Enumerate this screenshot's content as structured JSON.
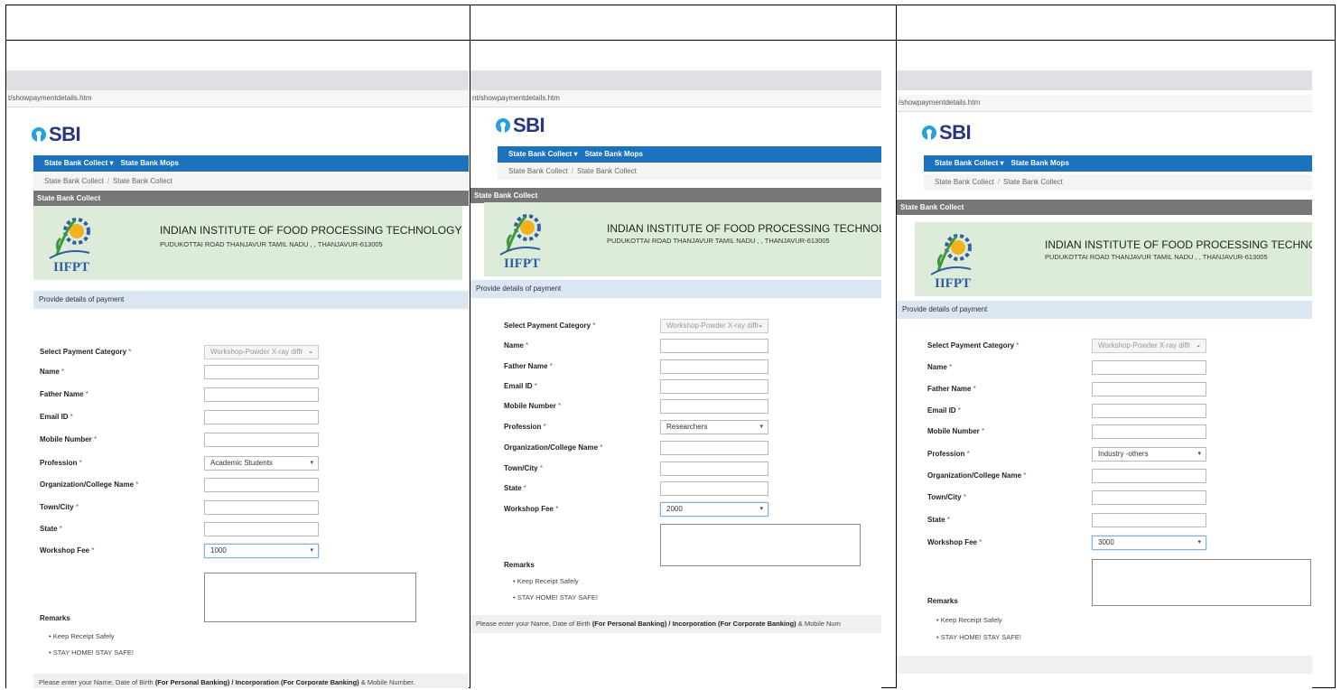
{
  "panels": [
    {
      "url": "t/showpaymentdetails.htm",
      "logo": "SBI",
      "nav": [
        "State Bank Collect ▾",
        "State Bank Mops"
      ],
      "breadcrumb": [
        "State Bank Collect",
        "State Bank Collect"
      ],
      "panel_title": "State Bank Collect",
      "institute_name": "INDIAN INSTITUTE OF FOOD PROCESSING TECHNOLOGY",
      "institute_address": "PUDUKOTTAI ROAD THANJAVUR TAMIL NADU , , THANJAVUR-613005",
      "emblem_text": "IIFPT",
      "section_title": "Provide details of payment",
      "labels": [
        "Select Payment Category *",
        "Name *",
        "Father Name *",
        "Email ID *",
        "Mobile Number *",
        "Profession *",
        "Organization/College Name *",
        "Town/City *",
        "State *",
        "Workshop Fee *"
      ],
      "payment_category": "Workshop-Powder X-ray diffr",
      "profession": "Academic Students",
      "workshop_fee": "1000",
      "remarks_title": "Remarks",
      "remarks": [
        "Keep Receipt Safely",
        "STAY HOME! STAY SAFE!"
      ],
      "footer_pre": "Please enter your Name, Date of Birth ",
      "footer_bold": "(For Personal Banking) / Incorporation (For Corporate Banking)",
      "footer_post": " & Mobile Number."
    },
    {
      "url": "nt/showpaymentdetails.htm",
      "logo": "SBI",
      "nav": [
        "State Bank Collect ▾",
        "State Bank Mops"
      ],
      "breadcrumb": [
        "State Bank Collect",
        "State Bank Collect"
      ],
      "panel_title": "State Bank Collect",
      "institute_name": "INDIAN INSTITUTE OF FOOD PROCESSING TECHNOLOGY",
      "institute_address": "PUDUKOTTAI ROAD THANJAVUR TAMIL NADU , , THANJAVUR-613005",
      "emblem_text": "IIFPT",
      "section_title": "Provide details of payment",
      "labels": [
        "Select Payment Category *",
        "Name *",
        "Father Name *",
        "Email ID *",
        "Mobile Number *",
        "Profession *",
        "Organization/College Name *",
        "Town/City *",
        "State *",
        "Workshop Fee *"
      ],
      "payment_category": "Workshop-Powder X-ray diffr",
      "profession": "Researchers",
      "workshop_fee": "2000",
      "remarks_title": "Remarks",
      "remarks": [
        "Keep Receipt Safely",
        "STAY HOME! STAY SAFE!"
      ],
      "footer_pre": "Please enter your Name, Date of Birth ",
      "footer_bold": "(For Personal Banking) / Incorporation (For Corporate Banking)",
      "footer_post": " & Mobile Num"
    },
    {
      "url": "/showpaymentdetails.htm",
      "logo": "SBI",
      "nav": [
        "State Bank Collect ▾",
        "State Bank Mops"
      ],
      "breadcrumb": [
        "State Bank Collect",
        "State Bank Collect"
      ],
      "panel_title": "State Bank Collect",
      "institute_name": "INDIAN INSTITUTE OF FOOD PROCESSING TECHNOLOGY",
      "institute_address": "PUDUKOTTAI ROAD THANJAVUR TAMIL NADU , , THANJAVUR-613005",
      "emblem_text": "IIFPT",
      "section_title": "Provide details of payment",
      "labels": [
        "Select Payment Category *",
        "Name *",
        "Father Name *",
        "Email ID *",
        "Mobile Number *",
        "Profession *",
        "Organization/College Name *",
        "Town/City *",
        "State *",
        "Workshop Fee *"
      ],
      "payment_category": "Workshop-Powder X-ray diffr",
      "profession": "Industry -others",
      "workshop_fee": "3000",
      "remarks_title": "Remarks",
      "remarks": [
        "Keep Receipt Safely",
        "STAY HOME! STAY SAFE!"
      ],
      "footer_pre": "",
      "footer_bold": "",
      "footer_post": ""
    }
  ],
  "colors": {
    "nav_blue": "#1b73c0",
    "sbi_blue": "#263586",
    "sbi_keyhole": "#1fa2e0",
    "banner_green": "#dcecd9",
    "section_blue": "#dae6f2",
    "panel_gray": "#777777"
  },
  "icons": [
    "sbi-logo-icon",
    "iifpt-emblem-icon",
    "chevron-down-icon",
    "bullet-icon"
  ]
}
